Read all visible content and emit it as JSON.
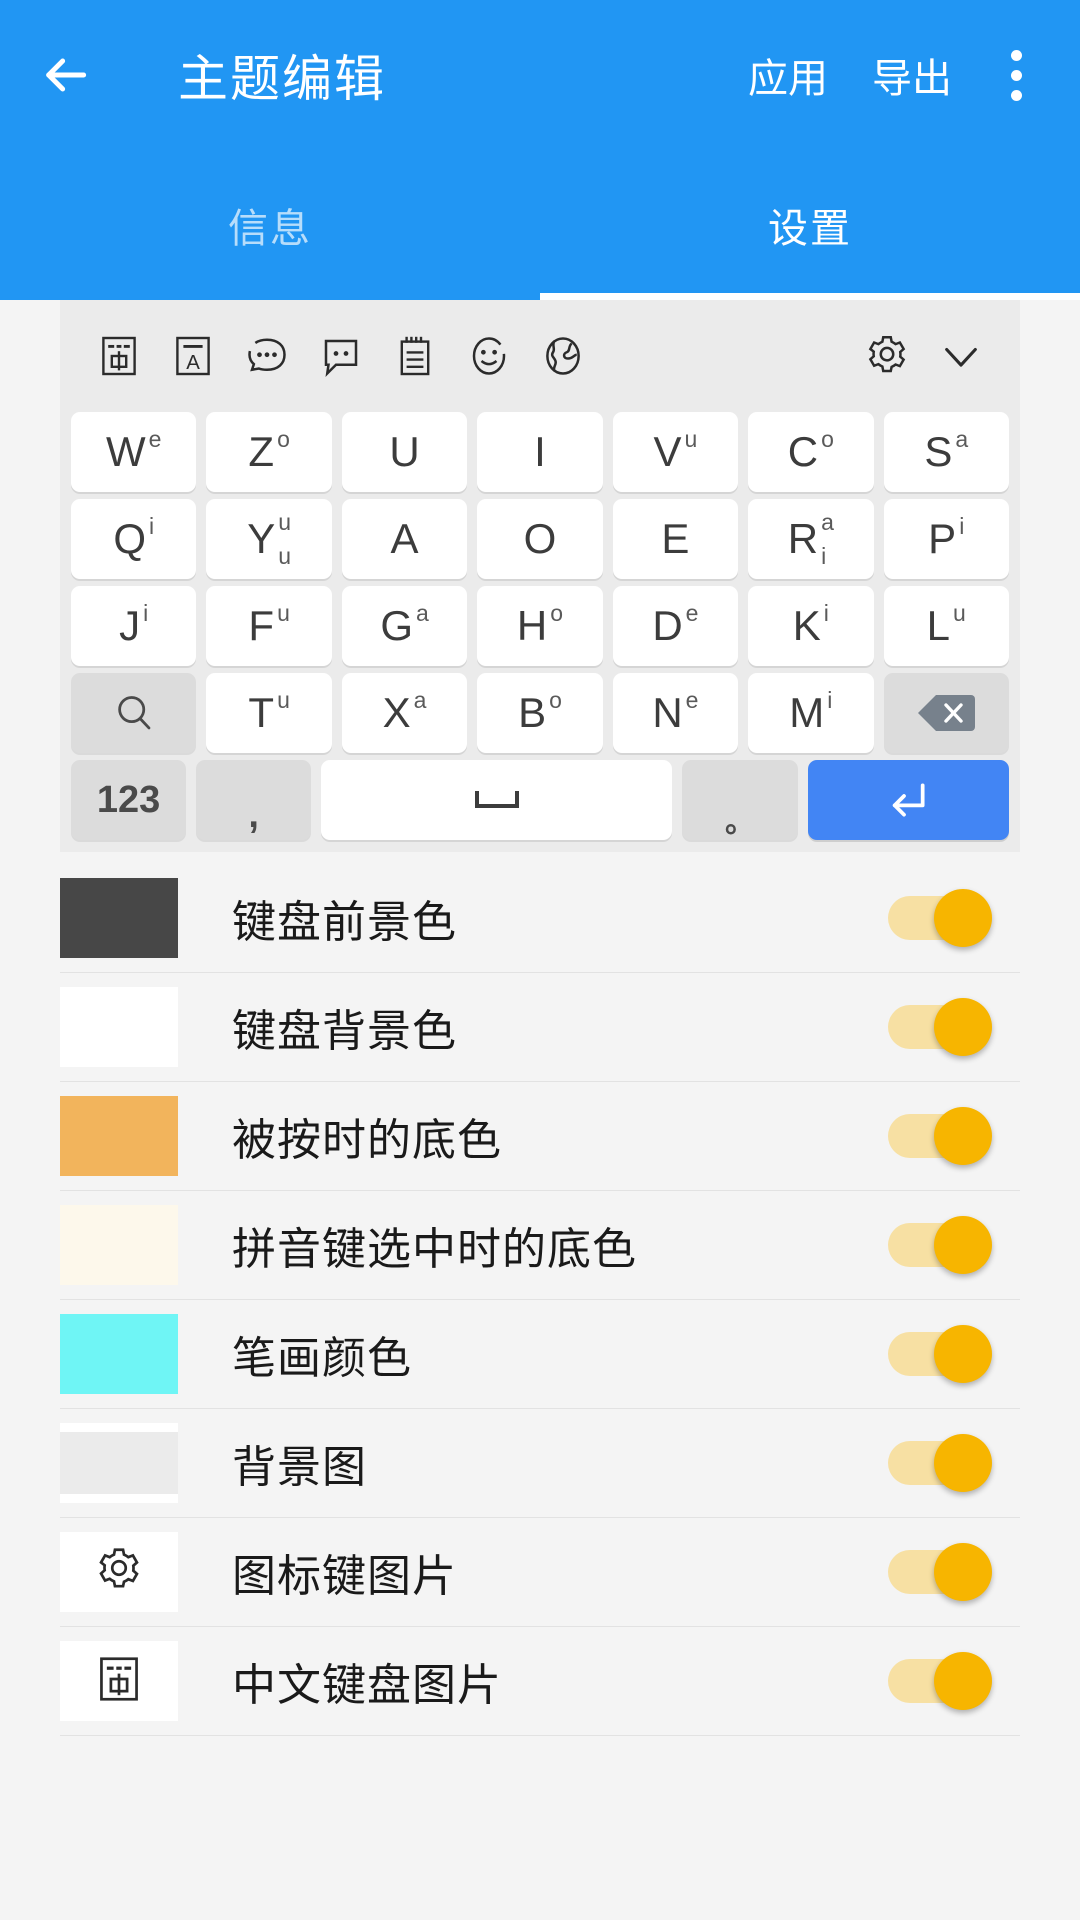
{
  "appbar": {
    "back_icon": "arrow-left-icon",
    "title": "主题编辑",
    "action_apply": "应用",
    "action_export": "导出",
    "overflow_icon": "more-vertical-icon",
    "background_color": "#2196F3"
  },
  "tabs": [
    {
      "label": "信息",
      "active": false
    },
    {
      "label": "设置",
      "active": true
    }
  ],
  "keyboard": {
    "background_color": "#EBEBEB",
    "toolbar": [
      {
        "icon": "chinese-input-icon",
        "label": "中"
      },
      {
        "icon": "english-input-icon",
        "label": "A"
      },
      {
        "icon": "ellipsis-bubble-icon",
        "label": ""
      },
      {
        "icon": "speech-bubble-icon",
        "label": ""
      },
      {
        "icon": "clipboard-icon",
        "label": ""
      },
      {
        "icon": "smiley-icon",
        "label": ""
      },
      {
        "icon": "globe-icon",
        "label": ""
      },
      {
        "icon": "gear-icon",
        "label": ""
      },
      {
        "icon": "chevron-down-icon",
        "label": ""
      }
    ],
    "rows": [
      [
        {
          "main": "W",
          "sup": "e"
        },
        {
          "main": "Z",
          "sup": "o"
        },
        {
          "main": "U",
          "sup": ""
        },
        {
          "main": "I",
          "sup": ""
        },
        {
          "main": "V",
          "sup": "u"
        },
        {
          "main": "C",
          "sup": "o"
        },
        {
          "main": "S",
          "sup": "a"
        }
      ],
      [
        {
          "main": "Q",
          "sup": "i"
        },
        {
          "main": "Y",
          "sup_stack": [
            "u",
            "u"
          ]
        },
        {
          "main": "A",
          "sup": ""
        },
        {
          "main": "O",
          "sup": ""
        },
        {
          "main": "E",
          "sup": ""
        },
        {
          "main": "R",
          "sup_stack": [
            "a",
            "i"
          ]
        },
        {
          "main": "P",
          "sup": "i"
        }
      ],
      [
        {
          "main": "J",
          "sup": "i"
        },
        {
          "main": "F",
          "sup": "u"
        },
        {
          "main": "G",
          "sup": "a"
        },
        {
          "main": "H",
          "sup": "o"
        },
        {
          "main": "D",
          "sup": "e"
        },
        {
          "main": "K",
          "sup": "i"
        },
        {
          "main": "L",
          "sup": "u"
        }
      ],
      [
        {
          "icon": "search-icon",
          "type": "func"
        },
        {
          "main": "T",
          "sup": "u"
        },
        {
          "main": "X",
          "sup": "a"
        },
        {
          "main": "B",
          "sup": "o"
        },
        {
          "main": "N",
          "sup": "e"
        },
        {
          "main": "M",
          "sup": "i"
        },
        {
          "icon": "backspace-icon",
          "type": "func"
        }
      ]
    ],
    "bottom_row": [
      {
        "main": "123",
        "type": "func"
      },
      {
        "main": ",",
        "type": "func"
      },
      {
        "icon": "space-icon",
        "type": "space"
      },
      {
        "main": "。",
        "type": "func"
      },
      {
        "icon": "enter-icon",
        "type": "accent"
      }
    ],
    "accent_key_color": "#4285F4"
  },
  "settings": {
    "toggle_track_color": "#F7E0A3",
    "toggle_thumb_color": "#F7B500",
    "items": [
      {
        "label": "键盘前景色",
        "swatch_color": "#474747",
        "swatch_kind": "color",
        "toggle_on": true
      },
      {
        "label": "键盘背景色",
        "swatch_color": "#FFFFFF",
        "swatch_kind": "color",
        "toggle_on": true
      },
      {
        "label": "被按时的底色",
        "swatch_color": "#F2B45C",
        "swatch_kind": "color",
        "toggle_on": true
      },
      {
        "label": "拼音键选中时的底色",
        "swatch_color": "#FDF8EB",
        "swatch_kind": "color",
        "toggle_on": true
      },
      {
        "label": "笔画颜色",
        "swatch_color": "#6FF5F5",
        "swatch_kind": "color",
        "toggle_on": true
      },
      {
        "label": "背景图",
        "swatch_color": "#EBEBEB",
        "swatch_kind": "image",
        "toggle_on": true
      },
      {
        "label": "图标键图片",
        "swatch_color": "#FFFFFF",
        "swatch_kind": "gear-icon",
        "toggle_on": true
      },
      {
        "label": "中文键盘图片",
        "swatch_color": "#FFFFFF",
        "swatch_kind": "chinese-input-icon",
        "toggle_on": true
      }
    ]
  }
}
